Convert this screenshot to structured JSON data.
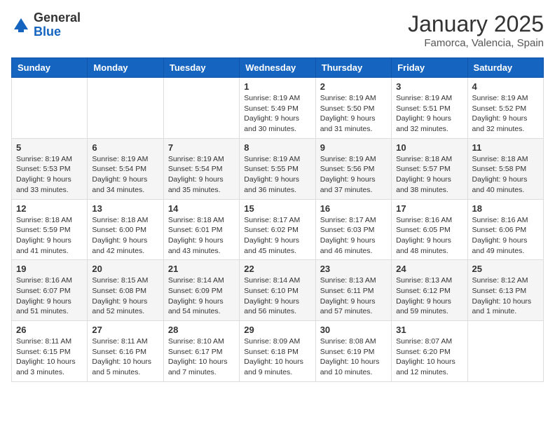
{
  "logo": {
    "general": "General",
    "blue": "Blue"
  },
  "header": {
    "month": "January 2025",
    "location": "Famorca, Valencia, Spain"
  },
  "weekdays": [
    "Sunday",
    "Monday",
    "Tuesday",
    "Wednesday",
    "Thursday",
    "Friday",
    "Saturday"
  ],
  "weeks": [
    [
      {
        "day": "",
        "info": ""
      },
      {
        "day": "",
        "info": ""
      },
      {
        "day": "",
        "info": ""
      },
      {
        "day": "1",
        "info": "Sunrise: 8:19 AM\nSunset: 5:49 PM\nDaylight: 9 hours\nand 30 minutes."
      },
      {
        "day": "2",
        "info": "Sunrise: 8:19 AM\nSunset: 5:50 PM\nDaylight: 9 hours\nand 31 minutes."
      },
      {
        "day": "3",
        "info": "Sunrise: 8:19 AM\nSunset: 5:51 PM\nDaylight: 9 hours\nand 32 minutes."
      },
      {
        "day": "4",
        "info": "Sunrise: 8:19 AM\nSunset: 5:52 PM\nDaylight: 9 hours\nand 32 minutes."
      }
    ],
    [
      {
        "day": "5",
        "info": "Sunrise: 8:19 AM\nSunset: 5:53 PM\nDaylight: 9 hours\nand 33 minutes."
      },
      {
        "day": "6",
        "info": "Sunrise: 8:19 AM\nSunset: 5:54 PM\nDaylight: 9 hours\nand 34 minutes."
      },
      {
        "day": "7",
        "info": "Sunrise: 8:19 AM\nSunset: 5:54 PM\nDaylight: 9 hours\nand 35 minutes."
      },
      {
        "day": "8",
        "info": "Sunrise: 8:19 AM\nSunset: 5:55 PM\nDaylight: 9 hours\nand 36 minutes."
      },
      {
        "day": "9",
        "info": "Sunrise: 8:19 AM\nSunset: 5:56 PM\nDaylight: 9 hours\nand 37 minutes."
      },
      {
        "day": "10",
        "info": "Sunrise: 8:18 AM\nSunset: 5:57 PM\nDaylight: 9 hours\nand 38 minutes."
      },
      {
        "day": "11",
        "info": "Sunrise: 8:18 AM\nSunset: 5:58 PM\nDaylight: 9 hours\nand 40 minutes."
      }
    ],
    [
      {
        "day": "12",
        "info": "Sunrise: 8:18 AM\nSunset: 5:59 PM\nDaylight: 9 hours\nand 41 minutes."
      },
      {
        "day": "13",
        "info": "Sunrise: 8:18 AM\nSunset: 6:00 PM\nDaylight: 9 hours\nand 42 minutes."
      },
      {
        "day": "14",
        "info": "Sunrise: 8:18 AM\nSunset: 6:01 PM\nDaylight: 9 hours\nand 43 minutes."
      },
      {
        "day": "15",
        "info": "Sunrise: 8:17 AM\nSunset: 6:02 PM\nDaylight: 9 hours\nand 45 minutes."
      },
      {
        "day": "16",
        "info": "Sunrise: 8:17 AM\nSunset: 6:03 PM\nDaylight: 9 hours\nand 46 minutes."
      },
      {
        "day": "17",
        "info": "Sunrise: 8:16 AM\nSunset: 6:05 PM\nDaylight: 9 hours\nand 48 minutes."
      },
      {
        "day": "18",
        "info": "Sunrise: 8:16 AM\nSunset: 6:06 PM\nDaylight: 9 hours\nand 49 minutes."
      }
    ],
    [
      {
        "day": "19",
        "info": "Sunrise: 8:16 AM\nSunset: 6:07 PM\nDaylight: 9 hours\nand 51 minutes."
      },
      {
        "day": "20",
        "info": "Sunrise: 8:15 AM\nSunset: 6:08 PM\nDaylight: 9 hours\nand 52 minutes."
      },
      {
        "day": "21",
        "info": "Sunrise: 8:14 AM\nSunset: 6:09 PM\nDaylight: 9 hours\nand 54 minutes."
      },
      {
        "day": "22",
        "info": "Sunrise: 8:14 AM\nSunset: 6:10 PM\nDaylight: 9 hours\nand 56 minutes."
      },
      {
        "day": "23",
        "info": "Sunrise: 8:13 AM\nSunset: 6:11 PM\nDaylight: 9 hours\nand 57 minutes."
      },
      {
        "day": "24",
        "info": "Sunrise: 8:13 AM\nSunset: 6:12 PM\nDaylight: 9 hours\nand 59 minutes."
      },
      {
        "day": "25",
        "info": "Sunrise: 8:12 AM\nSunset: 6:13 PM\nDaylight: 10 hours\nand 1 minute."
      }
    ],
    [
      {
        "day": "26",
        "info": "Sunrise: 8:11 AM\nSunset: 6:15 PM\nDaylight: 10 hours\nand 3 minutes."
      },
      {
        "day": "27",
        "info": "Sunrise: 8:11 AM\nSunset: 6:16 PM\nDaylight: 10 hours\nand 5 minutes."
      },
      {
        "day": "28",
        "info": "Sunrise: 8:10 AM\nSunset: 6:17 PM\nDaylight: 10 hours\nand 7 minutes."
      },
      {
        "day": "29",
        "info": "Sunrise: 8:09 AM\nSunset: 6:18 PM\nDaylight: 10 hours\nand 9 minutes."
      },
      {
        "day": "30",
        "info": "Sunrise: 8:08 AM\nSunset: 6:19 PM\nDaylight: 10 hours\nand 10 minutes."
      },
      {
        "day": "31",
        "info": "Sunrise: 8:07 AM\nSunset: 6:20 PM\nDaylight: 10 hours\nand 12 minutes."
      },
      {
        "day": "",
        "info": ""
      }
    ]
  ]
}
